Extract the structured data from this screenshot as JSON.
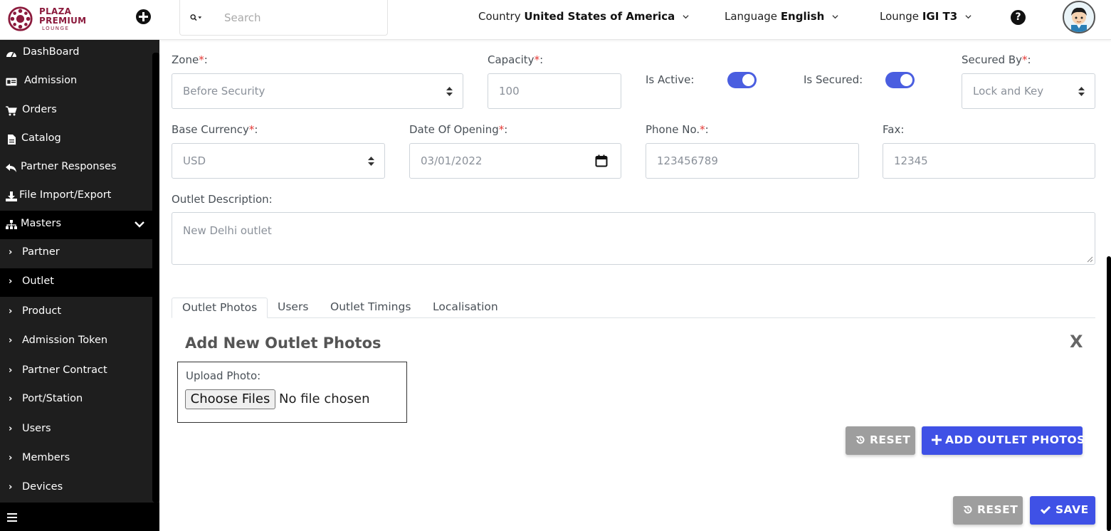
{
  "brand": {
    "line1": "PLAZA",
    "line2": "PREMIUM",
    "line3": "LOUNGE"
  },
  "header": {
    "search_placeholder": "Search",
    "country_label": "Country",
    "country_value": "United States of America",
    "language_label": "Language",
    "language_value": "English",
    "lounge_label": "Lounge",
    "lounge_value": "IGI T3",
    "help_glyph": "?"
  },
  "sidebar": {
    "items": [
      {
        "label": "DashBoard",
        "icon": "dashboard-icon"
      },
      {
        "label": "Admission",
        "icon": "id-card-icon"
      },
      {
        "label": "Orders",
        "icon": "cart-icon"
      },
      {
        "label": "Catalog",
        "icon": "file-icon"
      },
      {
        "label": "Partner Responses",
        "icon": "reply-icon"
      },
      {
        "label": "File Import/Export",
        "icon": "download-icon"
      },
      {
        "label": "Masters",
        "icon": "sitemap-icon"
      }
    ],
    "sub_items": [
      {
        "label": "Partner"
      },
      {
        "label": "Outlet"
      },
      {
        "label": "Product"
      },
      {
        "label": "Admission Token"
      },
      {
        "label": "Partner Contract"
      },
      {
        "label": "Port/Station"
      },
      {
        "label": "Users"
      },
      {
        "label": "Members"
      },
      {
        "label": "Devices"
      }
    ]
  },
  "form": {
    "zone_label": "Zone",
    "zone_value": "Before Security",
    "capacity_label": "Capacity",
    "capacity_value": "100",
    "is_active_label": "Is Active:",
    "is_active": true,
    "is_secured_label": "Is Secured:",
    "is_secured": true,
    "secured_by_label": "Secured By",
    "secured_by_value": "Lock and Key",
    "base_currency_label": "Base Currency",
    "base_currency_value": "USD",
    "date_opening_label": "Date Of Opening",
    "date_opening_value": "03/01/2022",
    "phone_label": "Phone No.",
    "phone_value": "123456789",
    "fax_label": "Fax:",
    "fax_value": "12345",
    "description_label": "Outlet Description:",
    "description_value": "New Delhi outlet",
    "required_mark": "*",
    "colon": ":"
  },
  "tabs": [
    "Outlet Photos",
    "Users",
    "Outlet Timings",
    "Localisation"
  ],
  "photos_panel": {
    "title": "Add New Outlet Photos",
    "close_glyph": "X",
    "upload_label": "Upload Photo:",
    "choose_button": "Choose Files",
    "no_file_text": "No file chosen",
    "reset_label": "RESET",
    "add_label": "ADD OUTLET PHOTOS"
  },
  "footer_actions": {
    "reset_label": "RESET",
    "save_label": "SAVE"
  },
  "colors": {
    "brand": "#8b1a3c",
    "primary": "#3f51e6",
    "toggle": "#4a5ee0",
    "required": "#e53935",
    "sidebar_bg": "#1e1e1e"
  }
}
